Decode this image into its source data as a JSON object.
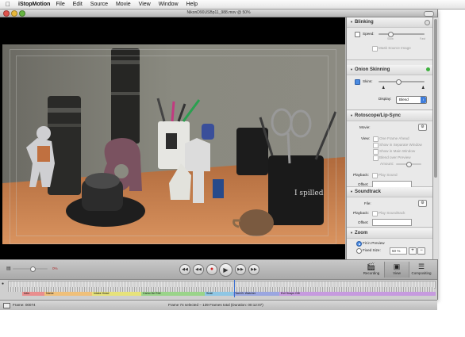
{
  "menubar": {
    "app": "iStopMotion",
    "items": [
      "File",
      "Edit",
      "Source",
      "Movie",
      "View",
      "Window",
      "Help"
    ]
  },
  "window": {
    "title": "NikonD90USBp11_988.mov @ 50%"
  },
  "inspector": {
    "blinking": {
      "title": "Blinking",
      "speed_label": "Speed:",
      "speed_value": 0.3,
      "slow_label": "Slow",
      "fast_label": "Fast",
      "mask_label": "Mask Source Image"
    },
    "onion": {
      "title": "Onion Skinning",
      "skins_label": "Skins:",
      "skins_value": 0.4,
      "display_label": "Display:",
      "display_value": "Blend"
    },
    "rotoscope": {
      "title": "Rotoscope/Lip-Sync",
      "movie_label": "Movie:",
      "view_label": "View:",
      "options": [
        "One Frame Ahead",
        "Show in Separate Window",
        "Show in Main Window",
        "Blend over Preview"
      ],
      "amount_label": "Amount:",
      "amount_value": 0.5,
      "playback_label": "Playback:",
      "play_sound_label": "Play Sound",
      "offset_label": "Offset:"
    },
    "soundtrack": {
      "title": "Soundtrack",
      "file_label": "File:",
      "playback_label": "Playback:",
      "play_label": "Play Soundtrack",
      "offset_label": "Offset:"
    },
    "zoom": {
      "title": "Zoom",
      "fit_label": "Fit in Preview",
      "fixed_label": "Fixed Size:",
      "fixed_value": "50 %"
    }
  },
  "controls": {
    "volume_value": "0%",
    "recording_label": "Recording",
    "view_label": "View",
    "compositing_label": "Compositing"
  },
  "timeline": {
    "markers": [
      "Intro",
      "Name",
      "Intake Head",
      "Camo De Rhil",
      "Snail",
      "Tacti B. Watcher",
      "Evil Snaps Gift"
    ],
    "playhead_fraction": 0.53
  },
  "status": {
    "frame_label": "Frame: 00074",
    "info": "Frame 74 selected – 139 Frames total (Duration: 00:12:07)"
  },
  "colors": {
    "accent": "#3f7ddb",
    "onion_indicator": "#3fb13f",
    "record": "#d02020"
  }
}
